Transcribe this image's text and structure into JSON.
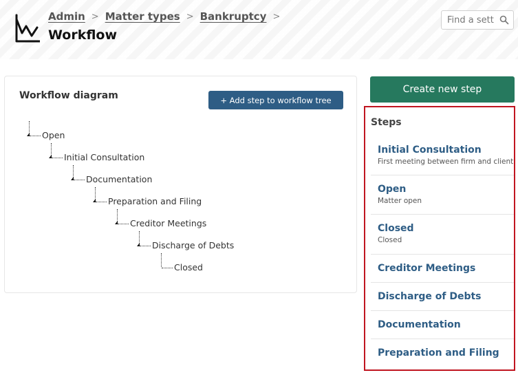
{
  "header": {
    "breadcrumb": [
      "Admin",
      "Matter types",
      "Bankruptcy"
    ],
    "breadcrumb_separator": ">",
    "title": "Workflow",
    "search_placeholder": "Find a sett"
  },
  "diagram": {
    "title": "Workflow diagram",
    "add_button_label": "+ Add step to workflow tree",
    "nodes": [
      {
        "label": "Open",
        "depth": 0
      },
      {
        "label": "Initial Consultation",
        "depth": 1
      },
      {
        "label": "Documentation",
        "depth": 2
      },
      {
        "label": "Preparation and Filing",
        "depth": 3
      },
      {
        "label": "Creditor Meetings",
        "depth": 4
      },
      {
        "label": "Discharge of Debts",
        "depth": 5
      },
      {
        "label": "Closed",
        "depth": 6
      }
    ]
  },
  "create_button_label": "Create new step",
  "steps": {
    "heading": "Steps",
    "items": [
      {
        "name": "Initial Consultation",
        "description": "First meeting between firm and client"
      },
      {
        "name": "Open",
        "description": "Matter open"
      },
      {
        "name": "Closed",
        "description": "Closed"
      },
      {
        "name": "Creditor Meetings",
        "description": ""
      },
      {
        "name": "Discharge of Debts",
        "description": ""
      },
      {
        "name": "Documentation",
        "description": ""
      },
      {
        "name": "Preparation and Filing",
        "description": ""
      }
    ]
  },
  "colors": {
    "primary_button": "#2e5d85",
    "create_button": "#26795e",
    "step_link": "#2e5d85",
    "highlight_border": "#c0141f"
  },
  "icons": {
    "logo": "line-chart-logo-icon",
    "search": "search-icon",
    "breadcrumb_separator": "chevron-right-icon"
  }
}
